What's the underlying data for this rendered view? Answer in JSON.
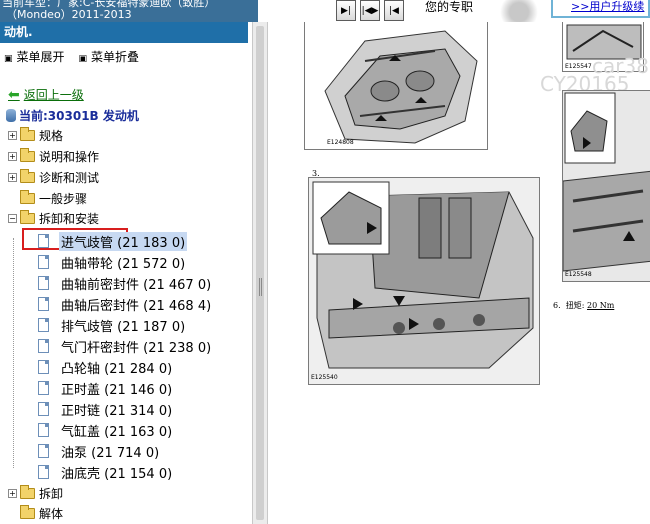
{
  "top": {
    "car_line1": "当前车型：厂家:C-长安福特蒙迪欧（致胜）",
    "car_line2": "（Mondeo）2011-2013",
    "nav_buttons": [
      "▶|",
      "|◀▶",
      "|◀"
    ],
    "your_pro": "您的专职",
    "upgrade_link": ">>用户升级续"
  },
  "left": {
    "header": "动机.",
    "menu_expand": "菜单展开",
    "menu_collapse": "菜单折叠",
    "back": "返回上一级",
    "current": "当前:30301B 发动机",
    "folders": [
      {
        "label": "规格",
        "expander": "+"
      },
      {
        "label": "说明和操作",
        "expander": "+"
      },
      {
        "label": "诊断和测试",
        "expander": "+"
      },
      {
        "label": "一般步骤",
        "expander": ""
      },
      {
        "label": "拆卸和安装",
        "expander": "−"
      }
    ],
    "leaves": [
      "进气歧管 (21 183 0)",
      "曲轴带轮 (21 572 0)",
      "曲轴前密封件 (21 467 0)",
      "曲轴后密封件 (21 468 4)",
      "排气歧管 (21 187 0)",
      "气门杆密封件 (21 238 0)",
      "凸轮轴 (21 284 0)",
      "正时盖 (21 146 0)",
      "正时链 (21 314 0)",
      "气缸盖 (21 163 0)",
      "油泵 (21 714 0)",
      "油底壳 (21 154 0)"
    ],
    "folders_after": [
      {
        "label": "拆卸",
        "expander": "+"
      },
      {
        "label": "解体",
        "expander": ""
      }
    ]
  },
  "content": {
    "fig1_caption": "E124808",
    "fig2_caption": "E125547",
    "fig3_caption": "E125540",
    "fig4_caption": "E125548",
    "step3": "3.",
    "step6_label": "6.",
    "step6_text": "扭矩:",
    "step6_value": "20 Nm",
    "watermark1": "car388",
    "watermark2": "CY20165"
  },
  "colors": {
    "header_bg": "#1f6fa8",
    "selected_bg": "#c7d9f2",
    "highlight_box": "#d81e1e",
    "back_link": "#0a6e0a",
    "current_text": "#1a2d9a"
  }
}
